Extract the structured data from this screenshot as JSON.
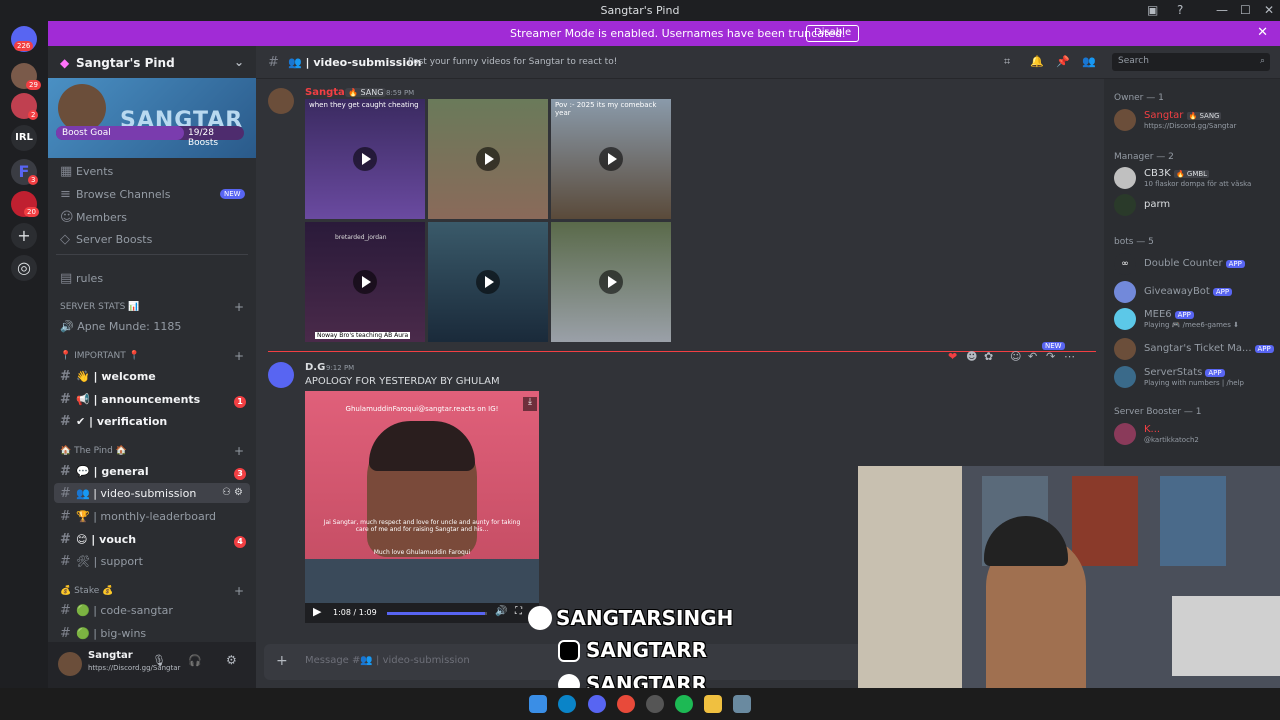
{
  "window": {
    "title": "Sangtar's Pind"
  },
  "streamer_bar": {
    "text": "Streamer Mode is enabled. Usernames have been truncated.",
    "button": "Disable"
  },
  "rail": {
    "badges": [
      "226",
      "29",
      "2",
      "3",
      "20"
    ],
    "irl_label": "IRL"
  },
  "server": {
    "name": "Sangtar's Pind",
    "banner_text": "SANGTAR",
    "boost_goal": {
      "label": "Boost Goal",
      "count": "19/28 Boosts",
      "progress": 0.68
    }
  },
  "sidebar": {
    "nav": [
      {
        "label": "Events",
        "icon": "calendar-icon"
      },
      {
        "label": "Browse Channels",
        "icon": "browse-icon",
        "badge": "NEW"
      },
      {
        "label": "Members",
        "icon": "members-icon"
      },
      {
        "label": "Server Boosts",
        "icon": "boost-icon"
      }
    ],
    "rules": "rules",
    "cat_stats": "SERVER STATS 📊",
    "stat_channel": "🔊 Apne Munde: 1185",
    "cat_important": "📍 IMPORTANT 📍",
    "important_channels": [
      {
        "label": "👋 | welcome",
        "bold": true
      },
      {
        "label": "📢 | announcements",
        "bold": true,
        "badge": "1"
      },
      {
        "label": "✔ | verification",
        "bold": true
      }
    ],
    "cat_pind": "🏠 The Pind 🏠",
    "pind_channels": [
      {
        "label": "💬 | general",
        "bold": true,
        "badge": "3"
      },
      {
        "label": "👥 | video-submission",
        "active": true
      },
      {
        "label": "🏆 | monthly-leaderboard"
      },
      {
        "label": "😊 | vouch",
        "bold": true,
        "badge": "4"
      },
      {
        "label": "🛠 | support"
      }
    ],
    "cat_stake": "💰 Stake 💰",
    "stake_channels": [
      {
        "label": "🟢 | code-sangtar"
      },
      {
        "label": "🟢 | big-wins"
      }
    ]
  },
  "user_panel": {
    "name": "Sangtar",
    "status": "https://Discord.gg/Sangtar"
  },
  "channel": {
    "name": "👥 | video-submission",
    "topic": "Post your funny videos for Sangtar to react to!",
    "search_placeholder": "Search"
  },
  "messages": [
    {
      "author": "Sangtar",
      "tag": "🔥 SANG",
      "time": "8:59 PM",
      "video_captions": [
        "when they get caught cheating",
        "",
        "Pov :- 2025 its my comeback year",
        "bretarded_jordan",
        "",
        ""
      ],
      "bottom_caption": "Noway Bro's teaching AB Aura"
    },
    {
      "author": "D.G",
      "time": "9:12 PM",
      "text": "APOLOGY FOR YESTERDAY BY GHULAM",
      "video_top": "GhulamuddinFaroqui@sangtar.reacts on IG!",
      "video_body": "Jai Sangtar, much respect and love for uncle and aunty for taking care of me and for raising Sangtar and his...",
      "video_sign": "Much love Ghulamuddin Faroqui",
      "video_time": "1:08 / 1:09",
      "progress": 0.98
    }
  ],
  "new_label": "NEW",
  "message_input": {
    "placeholder": "Message #👥 | video-submission"
  },
  "members": {
    "owner_heading": "Owner — 1",
    "owner": [
      {
        "name": "Sangtar",
        "tag": "🔥 SANG",
        "status": "https://Discord.gg/Sangtar",
        "color": "#f23f43"
      }
    ],
    "manager_heading": "Manager — 2",
    "managers": [
      {
        "name": "CB3K",
        "tag": "🔥 GMBL",
        "status": "10 flaskor dompa för att väska",
        "color": "#dbdee1"
      },
      {
        "name": "parm",
        "tag": "",
        "status": "",
        "color": "#dbdee1"
      }
    ],
    "bots_heading": "bots — 5",
    "bots": [
      {
        "name": "Double Counter",
        "app": "APP",
        "status": ""
      },
      {
        "name": "GiveawayBot",
        "app": "APP",
        "status": ""
      },
      {
        "name": "MEE6",
        "app": "APP",
        "status": "Playing 🎮 /mee6-games ⬇"
      },
      {
        "name": "Sangtar's Ticket Ma...",
        "app": "APP",
        "status": ""
      },
      {
        "name": "ServerStats",
        "app": "APP",
        "status": "Playing with numbers | /help"
      }
    ],
    "booster_heading": "Server Booster — 1",
    "boosters": [
      {
        "name": "K...",
        "status": "@kartikkatoch2",
        "color": "#f23f43"
      }
    ]
  },
  "overlay_socials": [
    "SANGTARSINGH",
    "SANGTARR",
    "SANGTARR"
  ]
}
